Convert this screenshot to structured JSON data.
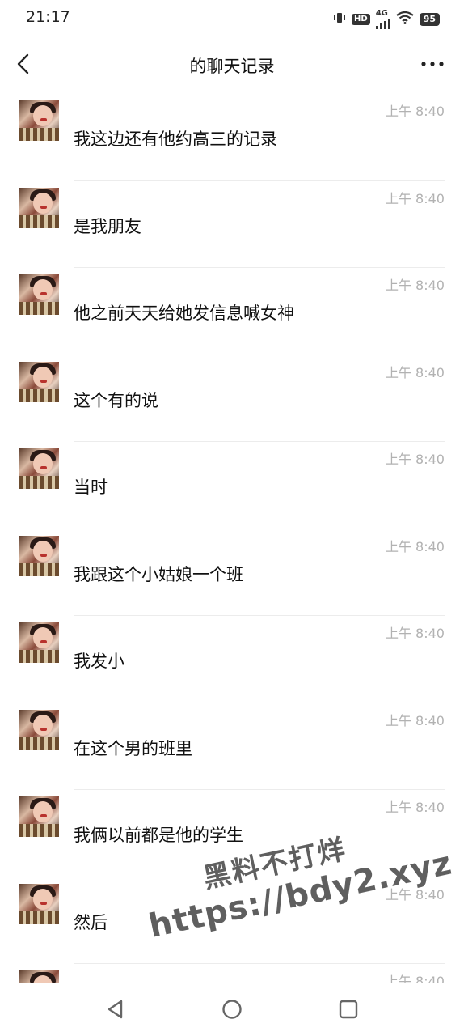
{
  "status_bar": {
    "time": "21:17",
    "vibrate_icon": "vibrate-icon",
    "hd_label": "HD",
    "network_label": "4G",
    "wifi_icon": "wifi-icon",
    "battery": "95"
  },
  "header": {
    "title": "的聊天记录",
    "back_icon": "chevron-left-icon",
    "more_icon": "more-dots-icon"
  },
  "messages": [
    {
      "time": "上午 8:40",
      "text": "我这边还有他约高三的记录"
    },
    {
      "time": "上午 8:40",
      "text": "是我朋友"
    },
    {
      "time": "上午 8:40",
      "text": "他之前天天给她发信息喊女神"
    },
    {
      "time": "上午 8:40",
      "text": "这个有的说"
    },
    {
      "time": "上午 8:40",
      "text": "当时"
    },
    {
      "time": "上午 8:40",
      "text": "我跟这个小姑娘一个班"
    },
    {
      "time": "上午 8:40",
      "text": "我发小"
    },
    {
      "time": "上午 8:40",
      "text": "在这个男的班里"
    },
    {
      "time": "上午 8:40",
      "text": "我俩以前都是他的学生"
    },
    {
      "time": "上午 8:40",
      "text": "然后"
    },
    {
      "time": "上午 8:40",
      "text": ""
    }
  ],
  "watermark": {
    "line1": "黑料不打烊",
    "line2": "https://bdy2.xyz"
  },
  "nav_bar": {
    "back_icon": "triangle-back-icon",
    "home_icon": "circle-home-icon",
    "recents_icon": "square-recents-icon"
  }
}
